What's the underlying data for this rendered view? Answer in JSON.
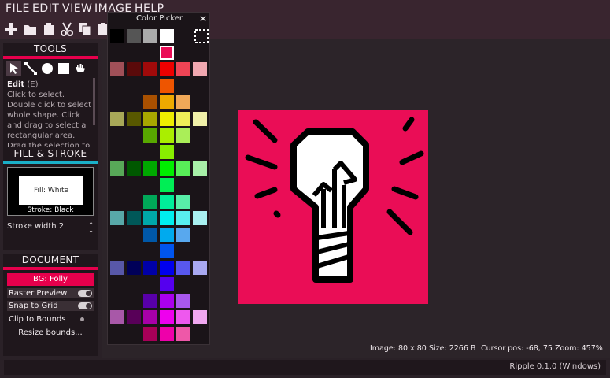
{
  "menu": {
    "file": "FILE",
    "edit": "EDIT",
    "view": "VIEW",
    "image": "IMAGE",
    "help": "HELP"
  },
  "tools_panel": {
    "title": "TOOLS",
    "help_title": "Edit",
    "help_shortcut": "(E)",
    "help_text": "Click to select. Double click to select whole shape. Click and drag to select a rectangular area. Drag the selection to move it."
  },
  "fill_panel": {
    "title": "FILL & STROKE",
    "fill_label": "Fill: White",
    "stroke_label": "Stroke: Black",
    "stroke_width_label": "Stroke width 2"
  },
  "document_panel": {
    "title": "DOCUMENT",
    "bg_button": "BG: Folly",
    "raster_preview": "Raster Preview",
    "snap_to_grid": "Snap to Grid",
    "clip_to_bounds": "Clip to Bounds",
    "resize_bounds": "Resize bounds..."
  },
  "picker": {
    "title": "Color Picker",
    "close": "✕"
  },
  "status": {
    "image": "Image: 80 x 80",
    "size": "Size: 2266 B",
    "cursor": "Cursor pos: -68, 75",
    "zoom": "Zoom: 457%"
  },
  "version": "Ripple 0.1.0 (Windows)",
  "colors": {
    "accent": "#e6004c",
    "cyan": "#1ab0c8",
    "artboard_bg": "#ea0d56"
  },
  "icons": [
    "add-icon",
    "folder-icon",
    "paste-icon",
    "cut-icon",
    "copy-icon",
    "clipboard-icon",
    "pointer-icon",
    "line-icon",
    "circle-icon",
    "rectangle-icon",
    "hand-icon",
    "lightbulb-icon",
    "marquee-icon"
  ],
  "palette_rows": [
    [
      "#000000",
      "#555555",
      "#aaaaaa",
      "#ffffff",
      null,
      null
    ],
    [
      null,
      null,
      null,
      "#ea0d56",
      null,
      null
    ],
    [
      "#a05058",
      "#5a0a0a",
      "#a00a0a",
      "#ee0000",
      "#ee4455",
      "#f0a8b0"
    ],
    [
      null,
      null,
      null,
      "#ee5500",
      null,
      null
    ],
    [
      null,
      null,
      "#a85000",
      "#eeaa00",
      "#f0a858",
      null
    ],
    [
      "#a8a858",
      "#585800",
      "#a8a800",
      "#eeee00",
      "#eeee58",
      "#f0f0a8"
    ],
    [
      null,
      null,
      "#58a800",
      "#aaee00",
      "#aaee58",
      null
    ],
    [
      null,
      null,
      null,
      "#88ee00",
      null,
      null
    ],
    [
      "#58a858",
      "#005800",
      "#00a800",
      "#00ee00",
      "#58ee58",
      "#a8f0a8"
    ],
    [
      null,
      null,
      null,
      "#00ee55",
      null,
      null
    ],
    [
      null,
      null,
      "#00a858",
      "#00ee99",
      "#58eea8",
      null
    ],
    [
      "#58a8a8",
      "#005858",
      "#00a8a8",
      "#00eeee",
      "#58eeee",
      "#a8f0f0"
    ],
    [
      null,
      null,
      "#0058a8",
      "#00aaee",
      "#58a8ee",
      null
    ],
    [
      null,
      null,
      null,
      "#0055ee",
      null,
      null
    ],
    [
      "#5858a8",
      "#000058",
      "#0000a8",
      "#0000ee",
      "#5858ee",
      "#a8a8f0"
    ],
    [
      null,
      null,
      null,
      "#5500ee",
      null,
      null
    ],
    [
      null,
      null,
      "#5800a8",
      "#aa00ee",
      "#a858ee",
      null
    ],
    [
      "#a858a8",
      "#580058",
      "#a800a8",
      "#ee00ee",
      "#ee58ee",
      "#f0a8f0"
    ],
    [
      null,
      null,
      "#a80058",
      "#ee00aa",
      "#ee58a8",
      null
    ]
  ]
}
